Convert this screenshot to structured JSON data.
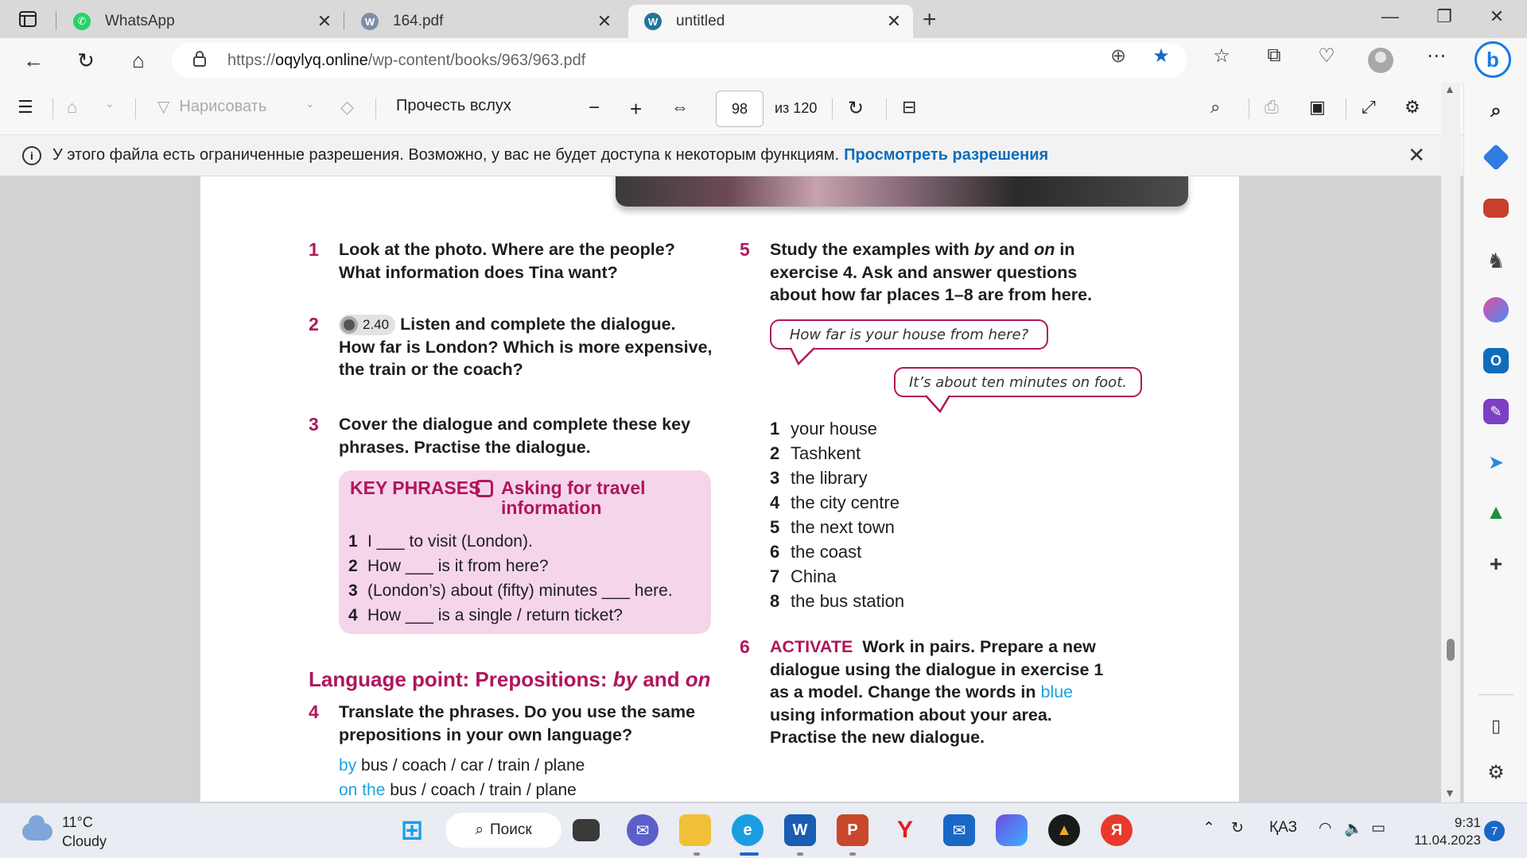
{
  "tabs": [
    {
      "title": "WhatsApp",
      "active": false,
      "icon": "whatsapp-icon"
    },
    {
      "title": "164.pdf",
      "active": false,
      "icon": "wordpress-icon"
    },
    {
      "title": "untitled",
      "active": true,
      "icon": "wordpress-icon"
    }
  ],
  "address": {
    "url_prefix": "https://",
    "url_domain": "oqylyq.online",
    "url_path": "/wp-content/books/963/963.pdf"
  },
  "pdf_toolbar": {
    "draw_label": "Нарисовать",
    "read_aloud_label": "Прочесть вслух",
    "page_current": "98",
    "page_total": "из 120"
  },
  "banner": {
    "text": "У этого файла есть ограниченные разрешения. Возможно, у вас не будет доступа к некоторым функциям.",
    "link": "Просмотреть разрешения"
  },
  "document": {
    "ex1": {
      "num": "1",
      "text": "Look at the photo. Where are the people? What information does Tina want?"
    },
    "ex2": {
      "num": "2",
      "audio": "2.40",
      "text": "Listen and complete the dialogue. How far is London? Which is more expensive, the train or the coach?"
    },
    "ex3": {
      "num": "3",
      "text": "Cover the dialogue and complete these key phrases. Practise the dialogue."
    },
    "key_phrases": {
      "title": "KEY PHRASES",
      "subtitle": "Asking for travel information",
      "items": [
        {
          "n": "1",
          "text": "I ___ to visit (London)."
        },
        {
          "n": "2",
          "text": "How ___ is it from here?"
        },
        {
          "n": "3",
          "text": "(London’s) about (fifty) minutes ___ here."
        },
        {
          "n": "4",
          "text": "How ___ is a single / return ticket?"
        }
      ]
    },
    "language_point": {
      "prefix": "Language point: Prepositions: ",
      "w1": "by",
      "mid": " and ",
      "w2": "on"
    },
    "ex4": {
      "num": "4",
      "text": "Translate the phrases. Do you use the same prepositions in your own language?"
    },
    "phrase1": {
      "blue": "by",
      "rest": " bus / coach / car / train / plane"
    },
    "phrase2": {
      "blue": "on the",
      "rest": " bus / coach / train / plane"
    },
    "ex5": {
      "num": "5",
      "t1": "Study the examples with ",
      "w1": "by",
      "t2": " and ",
      "w2": "on",
      "t3": " in exercise 4. Ask and answer questions about how far places 1–8 are from here."
    },
    "bubble1": "How far is your house from here?",
    "bubble2": "It’s about ten minutes on foot.",
    "places": [
      {
        "n": "1",
        "text": "your house"
      },
      {
        "n": "2",
        "text": "Tashkent"
      },
      {
        "n": "3",
        "text": "the library"
      },
      {
        "n": "4",
        "text": "the city centre"
      },
      {
        "n": "5",
        "text": "the next town"
      },
      {
        "n": "6",
        "text": "the coast"
      },
      {
        "n": "7",
        "text": "China"
      },
      {
        "n": "8",
        "text": "the bus station"
      }
    ],
    "ex6": {
      "num": "6",
      "label": "ACTIVATE",
      "t1": "Work in pairs. Prepare a new dialogue using the dialogue in exercise 1 as a model. Change the words in ",
      "blue": "blue",
      "t2": " using information about your area. Practise the new dialogue."
    }
  },
  "taskbar": {
    "weather_temp": "11°C",
    "weather_desc": "Cloudy",
    "search_label": "Поиск",
    "lang": "ҚАЗ",
    "time": "9:31",
    "date": "11.04.2023",
    "notifications": "7"
  },
  "colors": {
    "accent": "#b0165c",
    "link_blue": "#1aa5e0",
    "edge_blue": "#0f6cbd"
  }
}
